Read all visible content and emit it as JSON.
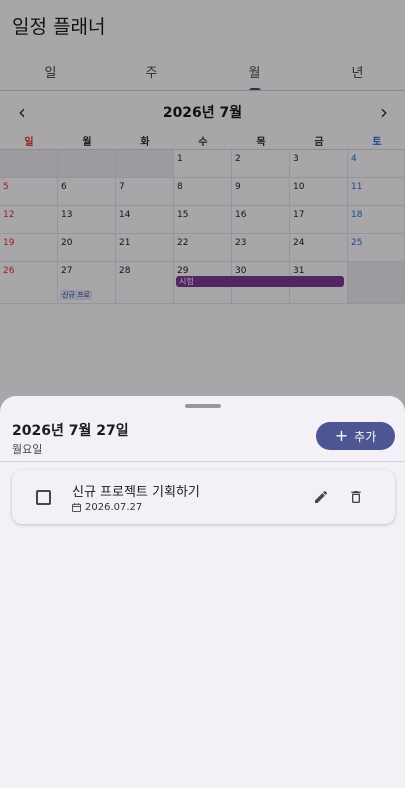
{
  "app": {
    "title": "일정 플래너",
    "tabs": [
      "일",
      "주",
      "월",
      "년"
    ],
    "selected_tab": "월"
  },
  "calendar": {
    "month_label": "2026년 7월",
    "prev_icon": "chevron-left-icon",
    "next_icon": "chevron-right-icon",
    "weekdays": [
      "일",
      "월",
      "화",
      "수",
      "목",
      "금",
      "토"
    ],
    "weeks": [
      [
        "",
        "",
        "",
        "1",
        "2",
        "3",
        "4"
      ],
      [
        "5",
        "6",
        "7",
        "8",
        "9",
        "10",
        "11"
      ],
      [
        "12",
        "13",
        "14",
        "15",
        "16",
        "17",
        "18"
      ],
      [
        "19",
        "20",
        "21",
        "22",
        "23",
        "24",
        "25"
      ],
      [
        "26",
        "27",
        "28",
        "29",
        "30",
        "31",
        ""
      ]
    ],
    "event_bar": {
      "label": "시험",
      "start_day": "29",
      "end_day": "31",
      "color": "#7b3a8f"
    },
    "chip": {
      "label": "신규 프로",
      "day": "27"
    },
    "sunday_color": "#d33333",
    "saturday_color": "#2a6fd6"
  },
  "sheet": {
    "date": "2026년 7월 27일",
    "weekday": "월요일",
    "add_label": "추가",
    "add_icon": "plus-icon",
    "accent": "#4d5592",
    "tasks": [
      {
        "title": "신규 프로젝트 기획하기",
        "date": "2026.07.27",
        "checked": false
      }
    ]
  }
}
